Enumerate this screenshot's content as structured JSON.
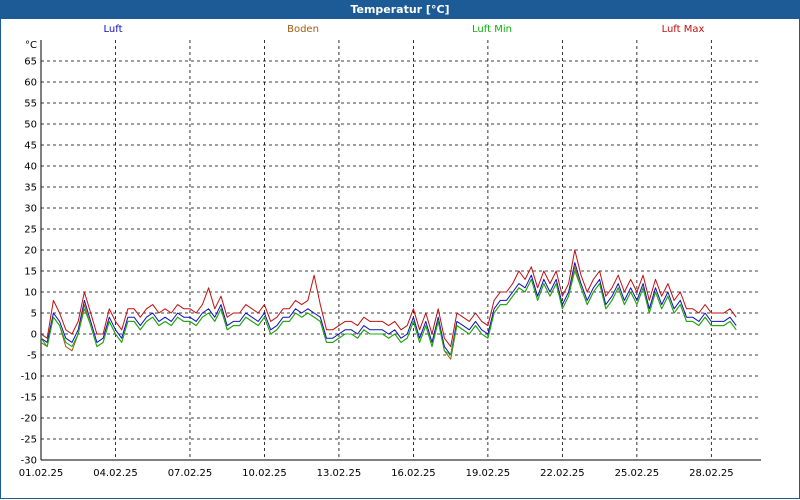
{
  "window": {
    "title": "Temperatur [°C]"
  },
  "chart_data": {
    "type": "line",
    "title": "Temperatur [°C]",
    "ylabel": "°C",
    "ylim": [
      -30,
      70
    ],
    "yticks": [
      -30,
      -25,
      -20,
      -15,
      -10,
      -5,
      0,
      5,
      10,
      15,
      20,
      25,
      30,
      35,
      40,
      45,
      50,
      55,
      60,
      65
    ],
    "xlim": [
      0,
      29
    ],
    "xticks": [
      {
        "x": 0,
        "label": "01.02.25"
      },
      {
        "x": 3,
        "label": "04.02.25"
      },
      {
        "x": 6,
        "label": "07.02.25"
      },
      {
        "x": 9,
        "label": "10.02.25"
      },
      {
        "x": 12,
        "label": "13.02.25"
      },
      {
        "x": 15,
        "label": "16.02.25"
      },
      {
        "x": 18,
        "label": "19.02.25"
      },
      {
        "x": 21,
        "label": "22.02.25"
      },
      {
        "x": 24,
        "label": "25.02.25"
      },
      {
        "x": 27,
        "label": "28.02.25"
      }
    ],
    "grid": true,
    "legend_position": "top",
    "x": [
      0,
      0.25,
      0.5,
      0.75,
      1,
      1.25,
      1.5,
      1.75,
      2,
      2.25,
      2.5,
      2.75,
      3,
      3.25,
      3.5,
      3.75,
      4,
      4.25,
      4.5,
      4.75,
      5,
      5.25,
      5.5,
      5.75,
      6,
      6.25,
      6.5,
      6.75,
      7,
      7.25,
      7.5,
      7.75,
      8,
      8.25,
      8.5,
      8.75,
      9,
      9.25,
      9.5,
      9.75,
      10,
      10.25,
      10.5,
      10.75,
      11,
      11.25,
      11.5,
      11.75,
      12,
      12.25,
      12.5,
      12.75,
      13,
      13.25,
      13.5,
      13.75,
      14,
      14.25,
      14.5,
      14.75,
      15,
      15.25,
      15.5,
      15.75,
      16,
      16.25,
      16.5,
      16.75,
      17,
      17.25,
      17.5,
      17.75,
      18,
      18.25,
      18.5,
      18.75,
      19,
      19.25,
      19.5,
      19.75,
      20,
      20.25,
      20.5,
      20.75,
      21,
      21.25,
      21.5,
      21.75,
      22,
      22.25,
      22.5,
      22.75,
      23,
      23.25,
      23.5,
      23.75,
      24,
      24.25,
      24.5,
      24.75,
      25,
      25.25,
      25.5,
      25.75,
      26,
      26.25,
      26.5,
      26.75,
      27,
      27.25,
      27.5,
      27.75,
      28,
      28.25,
      28.5,
      28.75,
      29
    ],
    "series": [
      {
        "name": "Luft",
        "color": "#1010c0",
        "values": [
          -1,
          -2,
          5,
          3,
          -1,
          -2,
          1,
          8,
          3,
          -2,
          -1,
          4,
          1,
          -1,
          4,
          4,
          2,
          4,
          5,
          3,
          4,
          3,
          5,
          4,
          4,
          3,
          5,
          6,
          4,
          7,
          2,
          3,
          3,
          5,
          4,
          3,
          5,
          1,
          2,
          4,
          4,
          6,
          5,
          6,
          5,
          4,
          -1,
          -1,
          0,
          1,
          1,
          0,
          2,
          1,
          1,
          1,
          0,
          1,
          -1,
          0,
          4,
          -1,
          3,
          -2,
          4,
          -3,
          -5,
          3,
          2,
          1,
          3,
          1,
          0,
          6,
          8,
          8,
          10,
          12,
          11,
          14,
          9,
          13,
          10,
          13,
          7,
          10,
          17,
          12,
          8,
          11,
          13,
          7,
          9,
          12,
          8,
          11,
          8,
          12,
          6,
          11,
          7,
          10,
          6,
          8,
          4,
          4,
          3,
          5,
          3,
          3,
          3,
          4,
          2
        ]
      },
      {
        "name": "Boden",
        "color": "#a05a10",
        "values": [
          -2,
          -3,
          4,
          2,
          -3,
          -4,
          0,
          7,
          2,
          -3,
          -2,
          3,
          0,
          -2,
          3,
          3,
          1,
          3,
          4,
          2,
          3,
          2,
          4,
          3,
          3,
          2,
          4,
          5,
          3,
          6,
          1,
          2,
          2,
          4,
          3,
          2,
          4,
          0,
          1,
          3,
          3,
          5,
          4,
          5,
          4,
          3,
          -2,
          -2,
          -1,
          0,
          0,
          -1,
          1,
          0,
          0,
          0,
          -1,
          0,
          -2,
          -1,
          3,
          -2,
          2,
          -3,
          3,
          -4,
          -6,
          2,
          1,
          0,
          2,
          0,
          -1,
          5,
          7,
          7,
          9,
          11,
          10,
          13,
          8,
          12,
          9,
          12,
          6,
          9,
          16,
          11,
          7,
          10,
          12,
          6,
          8,
          11,
          7,
          10,
          7,
          11,
          5,
          10,
          6,
          9,
          5,
          7,
          3,
          3,
          2,
          4,
          2,
          2,
          2,
          3,
          1
        ]
      },
      {
        "name": "Luft Min",
        "color": "#10b010",
        "values": [
          -1,
          -3,
          4,
          2,
          -2,
          -3,
          0,
          6,
          2,
          -3,
          -2,
          3,
          0,
          -2,
          3,
          3,
          1,
          3,
          4,
          2,
          3,
          2,
          4,
          3,
          3,
          2,
          4,
          5,
          3,
          6,
          1,
          2,
          2,
          4,
          3,
          2,
          4,
          0,
          1,
          3,
          3,
          5,
          4,
          5,
          4,
          3,
          -2,
          -2,
          -1,
          0,
          0,
          -1,
          1,
          0,
          0,
          0,
          -1,
          0,
          -2,
          -1,
          3,
          -2,
          2,
          -3,
          3,
          -4,
          -5,
          2,
          1,
          0,
          2,
          0,
          -1,
          5,
          7,
          7,
          9,
          11,
          10,
          13,
          8,
          12,
          9,
          12,
          6,
          9,
          15,
          11,
          7,
          10,
          12,
          6,
          8,
          11,
          7,
          10,
          7,
          11,
          5,
          10,
          6,
          9,
          5,
          7,
          3,
          3,
          2,
          4,
          2,
          2,
          2,
          3,
          1
        ]
      },
      {
        "name": "Luft Max",
        "color": "#c01010",
        "values": [
          0,
          -1,
          8,
          5,
          1,
          0,
          3,
          10,
          5,
          0,
          0,
          6,
          3,
          1,
          6,
          6,
          4,
          6,
          7,
          5,
          6,
          5,
          7,
          6,
          6,
          5,
          7,
          11,
          6,
          9,
          4,
          5,
          5,
          7,
          6,
          5,
          7,
          3,
          4,
          6,
          6,
          8,
          7,
          8,
          14,
          7,
          1,
          1,
          2,
          3,
          3,
          2,
          4,
          3,
          3,
          3,
          2,
          3,
          1,
          2,
          6,
          1,
          5,
          0,
          6,
          -1,
          -3,
          5,
          4,
          3,
          5,
          3,
          2,
          8,
          10,
          10,
          12,
          15,
          13,
          16,
          11,
          15,
          12,
          15,
          9,
          12,
          20,
          14,
          10,
          13,
          15,
          9,
          11,
          14,
          10,
          13,
          10,
          14,
          8,
          13,
          9,
          12,
          8,
          10,
          6,
          6,
          5,
          7,
          5,
          5,
          5,
          6,
          4
        ]
      }
    ]
  }
}
